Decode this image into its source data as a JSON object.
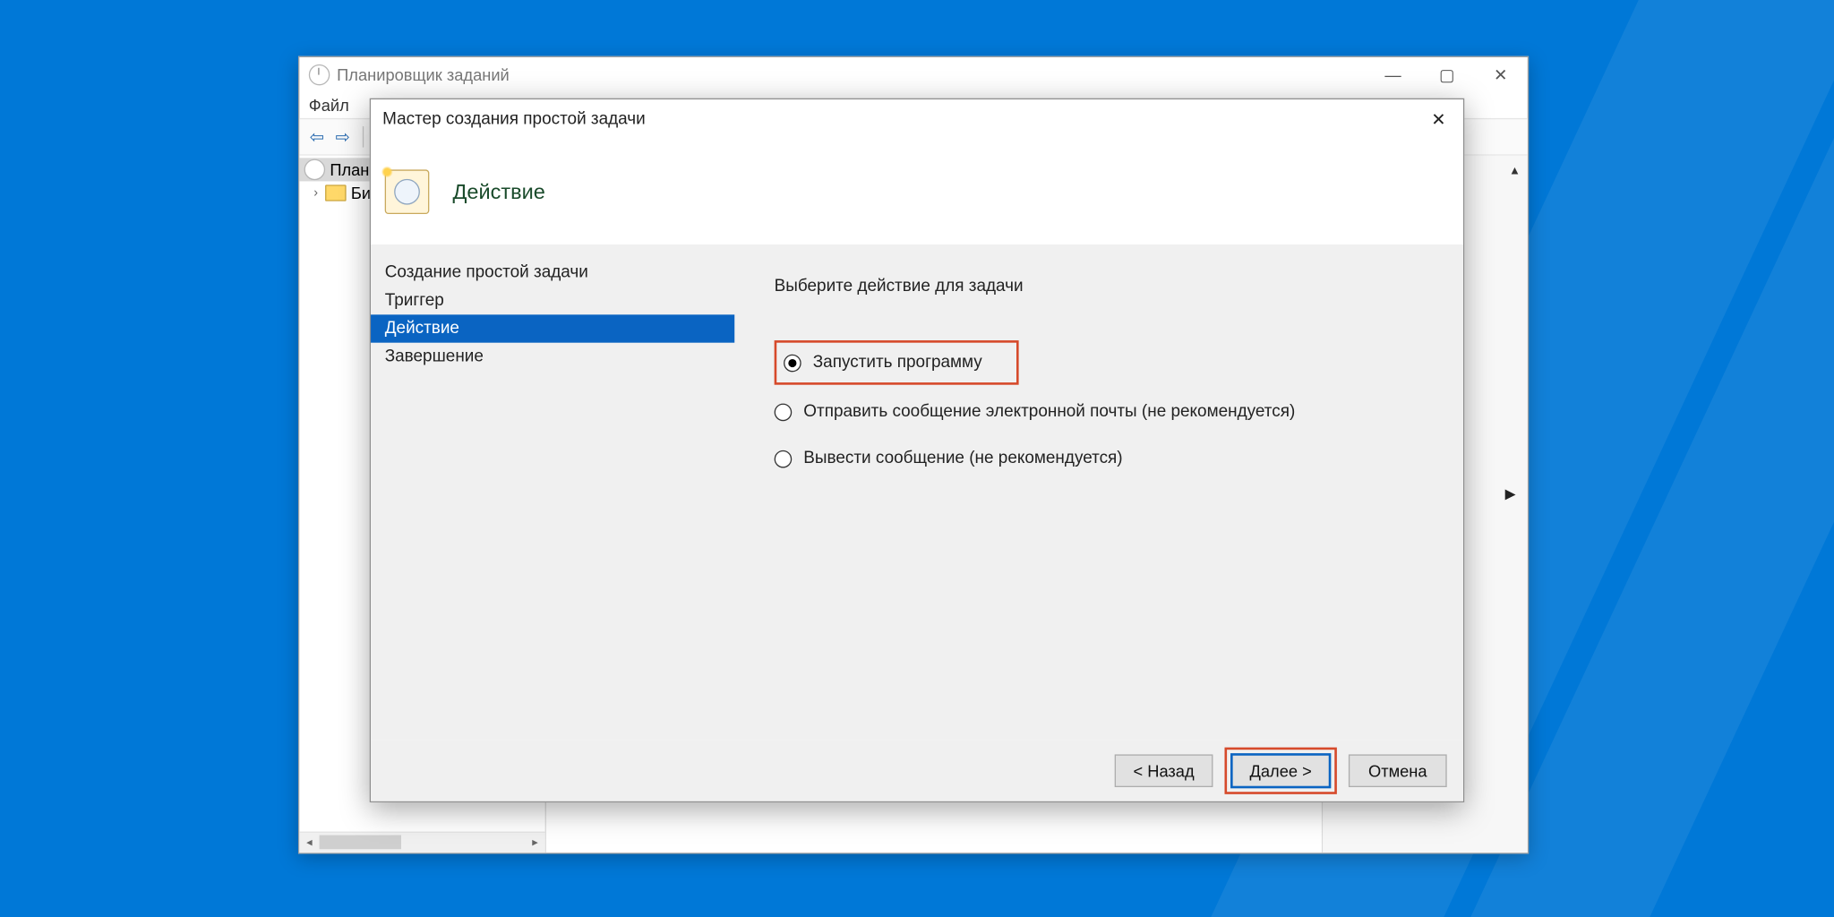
{
  "main_window": {
    "title": "Планировщик заданий",
    "menu": {
      "file": "Файл"
    },
    "tree": {
      "root": "Планировщик заданий",
      "library_short": "Библиотека"
    }
  },
  "dialog": {
    "title": "Мастер создания простой задачи",
    "heading": "Действие",
    "steps": {
      "create": "Создание простой задачи",
      "trigger": "Триггер",
      "action": "Действие",
      "finish": "Завершение"
    },
    "content": {
      "prompt": "Выберите действие для задачи",
      "opt_run": "Запустить программу",
      "opt_email": "Отправить сообщение электронной почты (не рекомендуется)",
      "opt_msg": "Вывести сообщение (не рекомендуется)"
    },
    "buttons": {
      "back": "< Назад",
      "next": "Далее >",
      "cancel": "Отмена"
    }
  }
}
